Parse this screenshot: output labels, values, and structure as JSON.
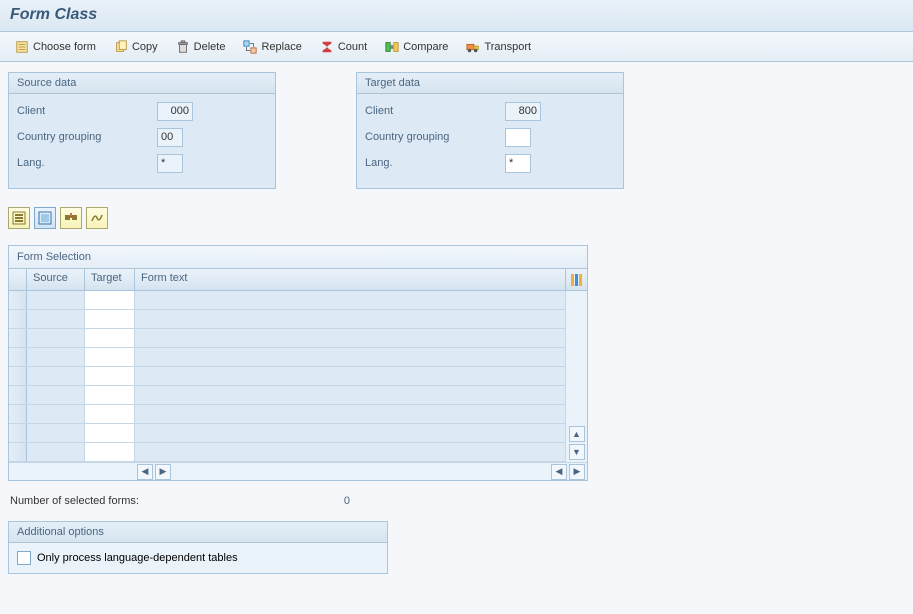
{
  "title": "Form Class",
  "toolbar": {
    "choose_form": "Choose form",
    "copy": "Copy",
    "delete": "Delete",
    "replace": "Replace",
    "count": "Count",
    "compare": "Compare",
    "transport": "Transport"
  },
  "panels": {
    "source": {
      "title": "Source data",
      "client_label": "Client",
      "client_value": "000",
      "country_label": "Country grouping",
      "country_value": "00",
      "lang_label": "Lang.",
      "lang_value": "*"
    },
    "target": {
      "title": "Target data",
      "client_label": "Client",
      "client_value": "800",
      "country_label": "Country grouping",
      "country_value": "",
      "lang_label": "Lang.",
      "lang_value": "*"
    }
  },
  "form_selection": {
    "title": "Form Selection",
    "col_source": "Source",
    "col_target": "Target",
    "col_formtext": "Form text"
  },
  "selected_forms": {
    "label": "Number of selected forms:",
    "value": "0"
  },
  "options": {
    "title": "Additional options",
    "checkbox_label": "Only process language-dependent tables"
  }
}
